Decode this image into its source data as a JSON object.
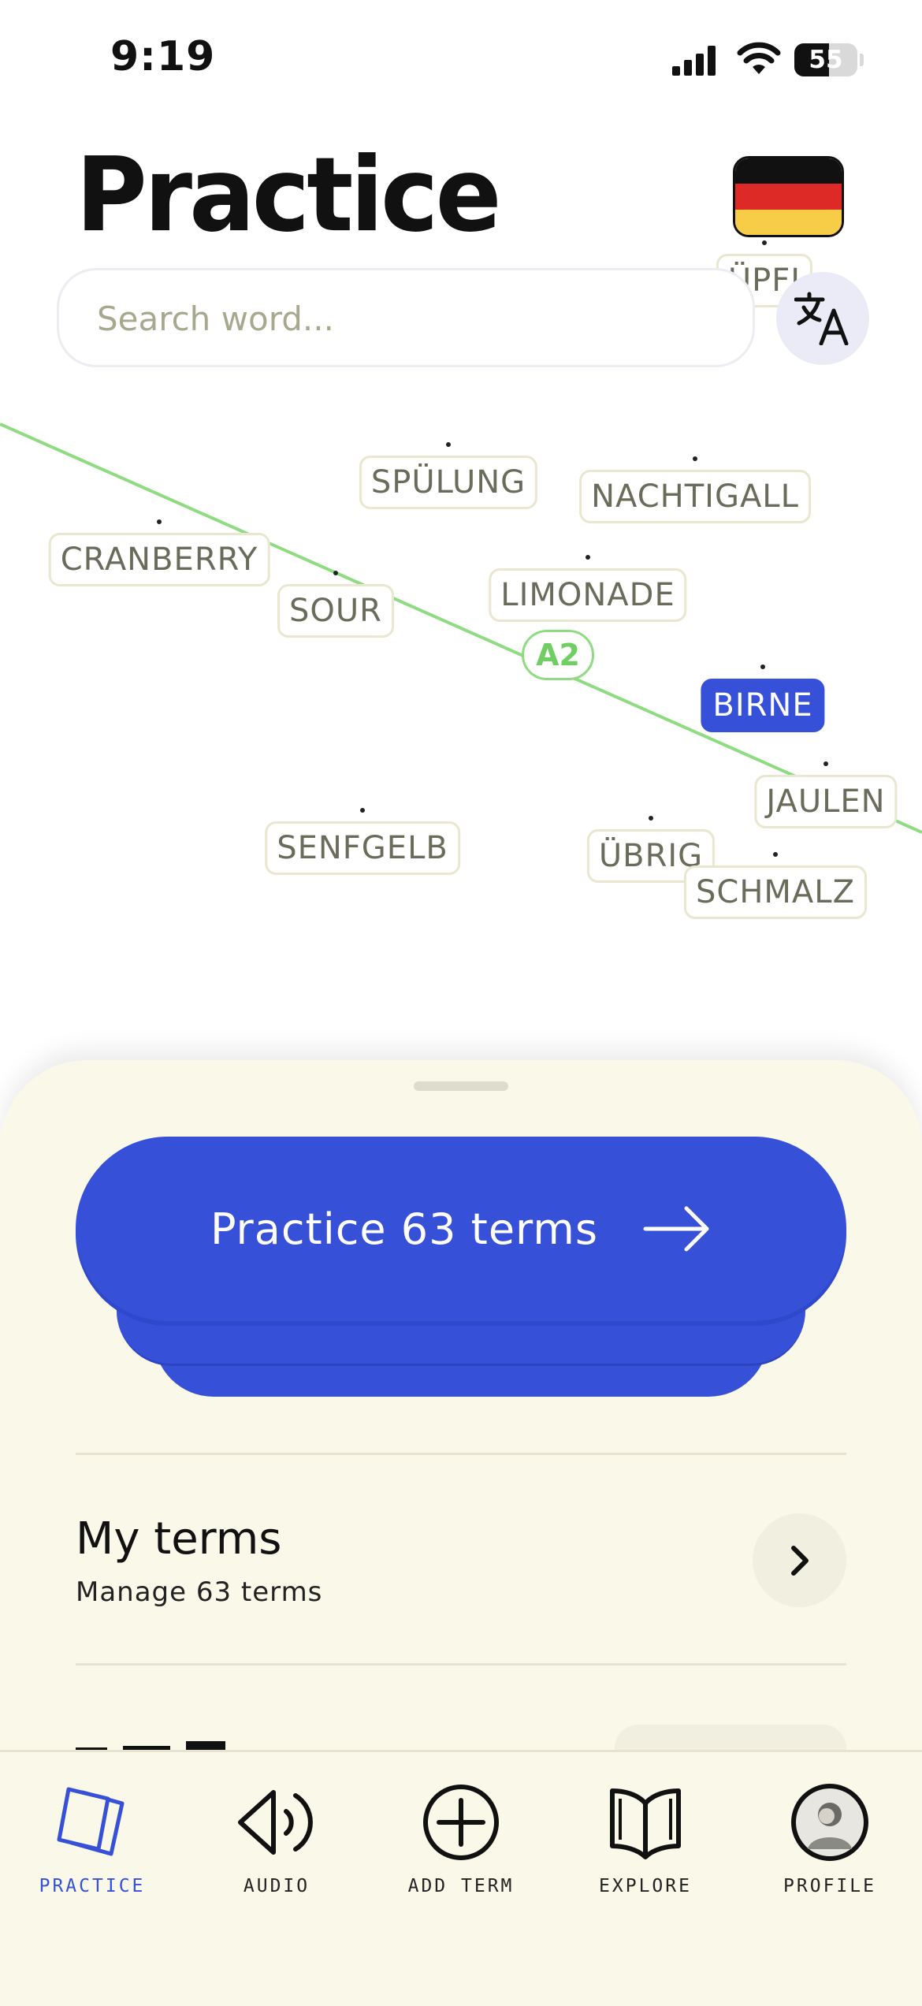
{
  "status_bar": {
    "time": "9:19",
    "battery_level": "55"
  },
  "header": {
    "title": "Practice",
    "flag": "germany-flag"
  },
  "search": {
    "placeholder": "Search word..."
  },
  "translate_button": {
    "icon": "translate-icon"
  },
  "word_map": {
    "level_badge": "A2",
    "partial_word": "ÜPFI",
    "words": [
      {
        "text": "SPÜLUNG",
        "selected": false
      },
      {
        "text": "NACHTIGALL",
        "selected": false
      },
      {
        "text": "CRANBERRY",
        "selected": false
      },
      {
        "text": "SOUR",
        "selected": false
      },
      {
        "text": "LIMONADE",
        "selected": false
      },
      {
        "text": "BIRNE",
        "selected": true
      },
      {
        "text": "JAULEN",
        "selected": false
      },
      {
        "text": "SENFGELB",
        "selected": false
      },
      {
        "text": "ÜBRIG",
        "selected": false
      },
      {
        "text": "SCHMALZ",
        "selected": false
      }
    ]
  },
  "practice": {
    "label": "Practice 63 terms",
    "icon": "arrow-right-icon"
  },
  "my_terms": {
    "title": "My terms",
    "subtitle": "Manage 63 terms",
    "icon": "chevron-right-icon"
  },
  "tabs": [
    {
      "label": "PRACTICE",
      "icon": "cards-icon",
      "active": true
    },
    {
      "label": "AUDIO",
      "icon": "speaker-icon",
      "active": false
    },
    {
      "label": "ADD TERM",
      "icon": "plus-circle-icon",
      "active": false
    },
    {
      "label": "EXPLORE",
      "icon": "book-icon",
      "active": false
    },
    {
      "label": "PROFILE",
      "icon": "avatar",
      "active": false
    }
  ],
  "colors": {
    "accent": "#3650d8",
    "sheet": "#faf8e8",
    "level_line": "#8fdb81"
  }
}
